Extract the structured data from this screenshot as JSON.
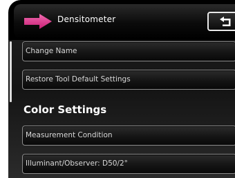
{
  "header": {
    "title": "Densitometer",
    "app_icon": "pink-arrow-icon",
    "back_icon": "return-arrow-icon"
  },
  "menu": {
    "items": [
      {
        "label": "Change Name"
      },
      {
        "label": "Restore Tool Default Settings"
      }
    ]
  },
  "color_settings": {
    "title": "Color Settings",
    "items": [
      {
        "label": "Measurement Condition"
      },
      {
        "label": "Illuminant/Observer: D50/2°"
      }
    ]
  },
  "colors": {
    "accent": "#e0308a",
    "background": "#000000",
    "text": "#ffffff"
  }
}
